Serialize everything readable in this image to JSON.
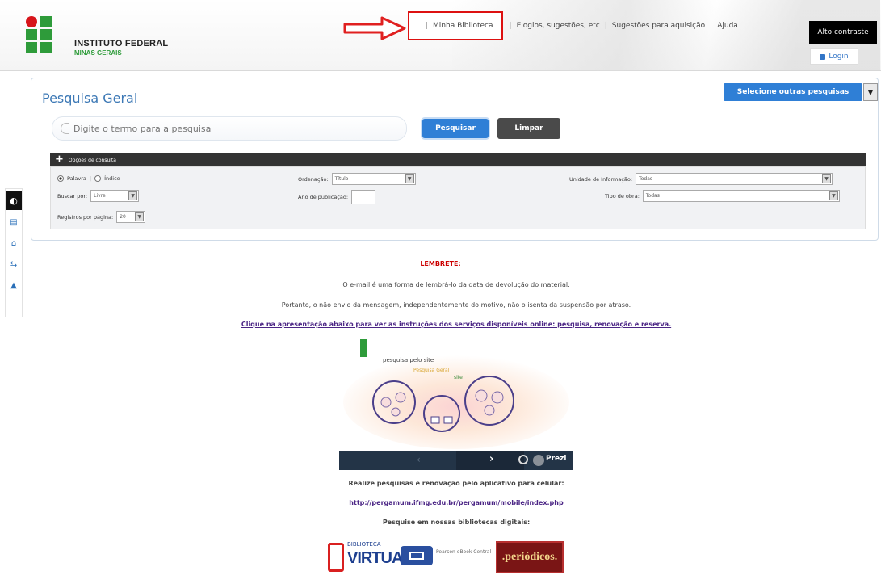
{
  "header": {
    "org_name": "INSTITUTO FEDERAL",
    "org_sub": "MINAS GERAIS",
    "nav": [
      "Minha Biblioteca",
      "Elogios, sugestões, etc",
      "Sugestões para aquisição",
      "Ajuda"
    ],
    "separator": "|",
    "alto_contraste": "Alto contraste",
    "login": "Login"
  },
  "sidebar": {
    "contrast_glyph": "◐",
    "icons": [
      "accessibility-icon",
      "home-icon",
      "sitemap-icon",
      "up-icon"
    ],
    "icon_glyphs": [
      "▤",
      "⌂",
      "⇆",
      "▲"
    ]
  },
  "search_panel": {
    "title": "Pesquisa Geral",
    "select_others": "Selecione outras pesquisas",
    "input_placeholder": "Digite o termo para a pesquisa",
    "btn_search": "Pesquisar",
    "btn_clear": "Limpar",
    "options_label": "Opções de consulta",
    "radio_palavra": "Palavra",
    "radio_indice": "Índice",
    "buscar_por_label": "Buscar por:",
    "buscar_por_value": "Livre",
    "registros_label": "Registros por página:",
    "registros_value": "20",
    "ordenacao_label": "Ordenação:",
    "ordenacao_value": "Título",
    "ano_label": "Ano de publicação:",
    "unidade_label": "Unidade de Informação:",
    "unidade_value": "Todas",
    "tipo_label": "Tipo de obra:",
    "tipo_value": "Todas"
  },
  "notice": {
    "title": "LEMBRETE:",
    "line1": "O e-mail é uma forma de lembrá-lo da data de devolução do material.",
    "line2": "Portanto, o não envio da mensagem, independentemente do motivo, não o isenta da suspensão por atraso.",
    "link": "Clique na apresentação abaixo para ver as instruções dos serviços disponíveis online: pesquisa, renovação e reserva."
  },
  "prezi": {
    "prev": "‹",
    "next": "›",
    "label": "Prezi",
    "diagram_title": "pesquisa pelo site",
    "diagram_sub": "Pesquisa Geral",
    "diagram_tag": "site"
  },
  "apps": {
    "line1": "Realize pesquisas e renovação pelo aplicativo para celular:",
    "link": "http://pergamum.ifmg.edu.br/pergamum/mobile/index.php",
    "line2": "Pesquise em nossas bibliotecas digitais:"
  },
  "libraries": {
    "virtual_top": "BIBLIOTECA",
    "virtual_name": "VIRTUAL",
    "ebook_caption": "Pearson eBook Central",
    "periodicos": ".periódicos."
  },
  "colors": {
    "accent_blue": "#2f7fd6",
    "brand_green": "#2e9b3a",
    "brand_red": "#d7141a",
    "notice_red": "#cc0000",
    "link_purple": "#4b2585"
  }
}
